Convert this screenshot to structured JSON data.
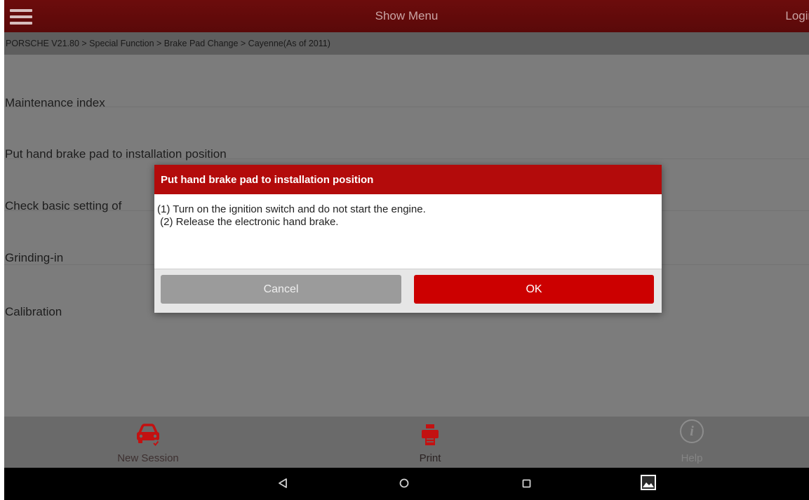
{
  "topbar": {
    "title": "Show Menu",
    "login_label": "Login"
  },
  "breadcrumb": "PORSCHE V21.80 > Special Function > Brake Pad Change > Cayenne(As of 2011)",
  "list": {
    "items": [
      "Maintenance index",
      "Put hand brake pad to installation position",
      "Check basic setting of",
      "Grinding-in",
      "Calibration"
    ]
  },
  "dialog": {
    "title": "Put hand brake pad to installation position",
    "lines": [
      "(1) Turn on the ignition switch and do not start the engine.",
      " (2) Release the electronic hand brake."
    ],
    "cancel_label": "Cancel",
    "ok_label": "OK"
  },
  "toolbar": {
    "new_session_label": "New Session",
    "print_label": "Print",
    "help_label": "Help",
    "help_glyph": "i"
  },
  "icons": {
    "menu": "hamburger-icon",
    "new_session": "car-icon",
    "print": "printer-icon",
    "help": "info-icon",
    "back": "back-triangle-icon",
    "home": "home-circle-icon",
    "recent": "recent-square-icon",
    "gallery": "gallery-icon"
  },
  "colors": {
    "topbar": "#6c0c0c",
    "dialog_title": "#b30b0b",
    "ok_button": "#cc0000",
    "cancel_button": "#9b9b9b",
    "toolbar_icons": "#c31111"
  }
}
